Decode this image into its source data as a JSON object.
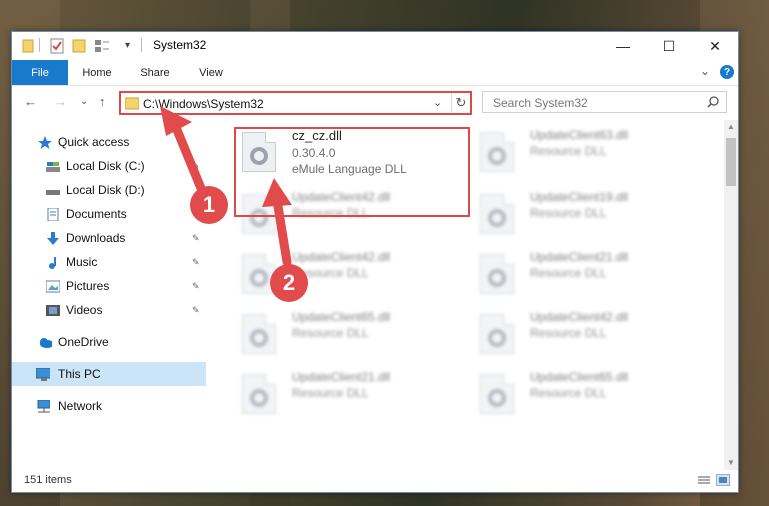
{
  "window": {
    "title": "System32",
    "minimize_label": "—",
    "maximize_label": "☐",
    "close_label": "✕"
  },
  "ribbon": {
    "tabs": [
      "File",
      "Home",
      "Share",
      "View"
    ],
    "help_label": "?",
    "expand_label": "⌄"
  },
  "nav": {
    "back": "←",
    "forward": "→",
    "recent": "⌄",
    "up": "↑",
    "address_path": "C:\\Windows\\System32",
    "dropdown": "⌄",
    "refresh": "↻",
    "search_placeholder": "Search System32"
  },
  "sidebar": {
    "items": [
      {
        "label": "Quick access",
        "icon": "star-icon"
      },
      {
        "label": "Local Disk (C:)",
        "icon": "drive-icon"
      },
      {
        "label": "Local Disk (D:)",
        "icon": "drive-icon"
      },
      {
        "label": "Documents",
        "icon": "documents-icon"
      },
      {
        "label": "Downloads",
        "icon": "download-icon"
      },
      {
        "label": "Music",
        "icon": "music-icon"
      },
      {
        "label": "Pictures",
        "icon": "pictures-icon"
      },
      {
        "label": "Videos",
        "icon": "videos-icon"
      },
      {
        "label": "OneDrive",
        "icon": "cloud-icon"
      },
      {
        "label": "This PC",
        "icon": "computer-icon"
      },
      {
        "label": "Network",
        "icon": "network-icon"
      }
    ],
    "pin_glyph": "📌"
  },
  "files": [
    {
      "name": "cz_cz.dll",
      "version": "0.30.4.0",
      "desc": "eMule Language DLL"
    },
    {
      "name": "UpdateClient63.dll",
      "desc": "Resource DLL"
    },
    {
      "name": "UpdateClient42.dll",
      "desc": "Resource DLL"
    },
    {
      "name": "UpdateClient19.dll",
      "desc": "Resource DLL"
    },
    {
      "name": "UpdateClient42.dll",
      "desc": "Resource DLL"
    },
    {
      "name": "UpdateClient21.dll",
      "desc": "Resource DLL"
    },
    {
      "name": "UpdateClient65.dll",
      "desc": "Resource DLL"
    },
    {
      "name": "UpdateClient42.dll",
      "desc": "Resource DLL"
    },
    {
      "name": "UpdateClient21.dll",
      "desc": "Resource DLL"
    },
    {
      "name": "UpdateClient65.dll",
      "desc": "Resource DLL"
    }
  ],
  "status": {
    "item_count": "151 items"
  },
  "annotations": {
    "marker_1": "1",
    "marker_2": "2"
  },
  "colors": {
    "accent": "#1979ca",
    "highlight": "#d94a4a",
    "selected_nav": "#cce4f7"
  }
}
